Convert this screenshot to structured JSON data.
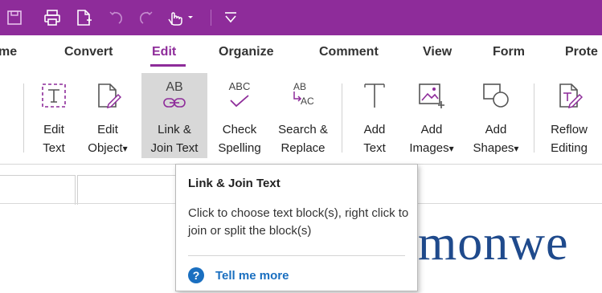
{
  "colors": {
    "title_bar": "#8e2c9a",
    "active_tab": "#8e2c9a",
    "link": "#1a6fc0",
    "doc_text": "#1f4a8c",
    "hover_bg": "#d8d8d8"
  },
  "quick_access": [
    "save-icon",
    "print-icon",
    "new-document-icon",
    "undo-icon",
    "redo-icon",
    "hand-tool-icon",
    "customize-toolbar-icon"
  ],
  "tabs": [
    {
      "label": "me",
      "active": false
    },
    {
      "label": "Convert",
      "active": false
    },
    {
      "label": "Edit",
      "active": true
    },
    {
      "label": "Organize",
      "active": false
    },
    {
      "label": "Comment",
      "active": false
    },
    {
      "label": "View",
      "active": false
    },
    {
      "label": "Form",
      "active": false
    },
    {
      "label": "Prote",
      "active": false
    }
  ],
  "ribbon": {
    "edit_text": {
      "line1": "Edit",
      "line2": "Text",
      "icon": "edit-text-icon"
    },
    "edit_object": {
      "line1": "Edit",
      "line2": "Object",
      "arrow": "▾",
      "icon": "edit-object-icon"
    },
    "link_join": {
      "line1": "Link &",
      "line2": "Join Text",
      "icon": "link-join-text-icon",
      "icon_text": "AB"
    },
    "check_spelling": {
      "line1": "Check",
      "line2": "Spelling",
      "icon": "check-spelling-icon",
      "icon_text": "ABC"
    },
    "search_replace": {
      "line1": "Search &",
      "line2": "Replace",
      "icon": "search-replace-icon",
      "icon_text_top": "AB",
      "icon_text_bottom": "AC"
    },
    "add_text": {
      "line1": "Add",
      "line2": "Text",
      "icon": "add-text-icon"
    },
    "add_images": {
      "line1": "Add",
      "line2": "Images",
      "arrow": "▾",
      "icon": "add-images-icon"
    },
    "add_shapes": {
      "line1": "Add",
      "line2": "Shapes",
      "arrow": "▾",
      "icon": "add-shapes-icon"
    },
    "reflow_editing": {
      "line1": "Reflow",
      "line2": "Editing",
      "icon": "reflow-editing-icon"
    }
  },
  "tooltip": {
    "title": "Link & Join Text",
    "description": "Click to choose text block(s), right click to join or split the block(s)",
    "link_icon": "?",
    "link": "Tell me more"
  },
  "document": {
    "visible_text": "monwe"
  }
}
